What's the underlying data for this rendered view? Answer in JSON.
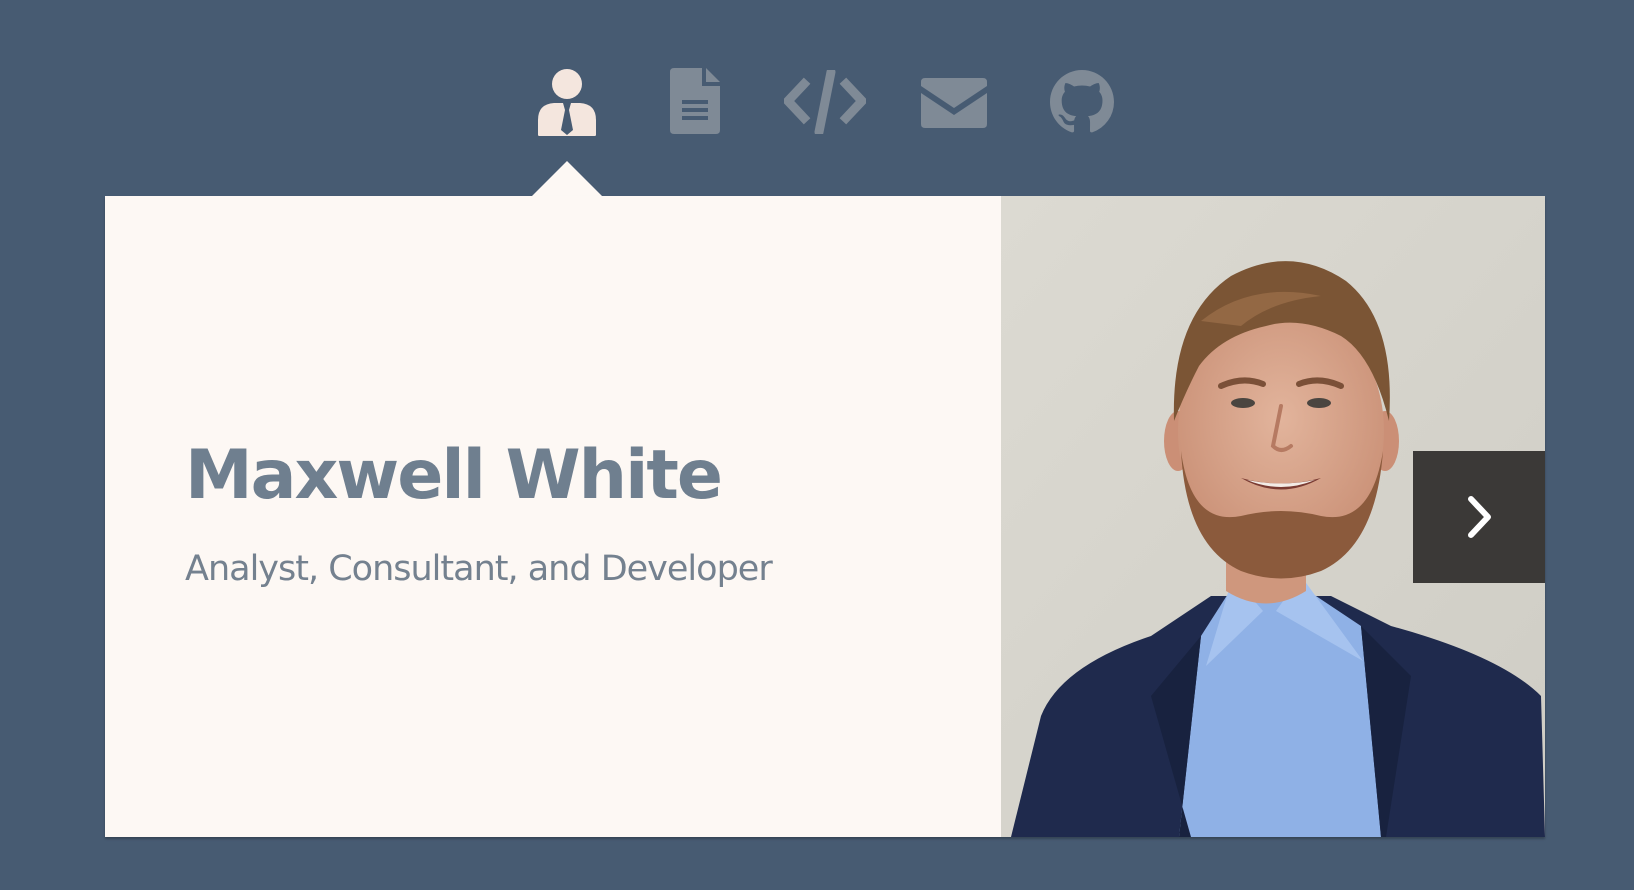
{
  "nav": {
    "items": [
      {
        "icon": "person-with-tie-icon",
        "active": true
      },
      {
        "icon": "document-icon",
        "active": false
      },
      {
        "icon": "code-icon",
        "active": false
      },
      {
        "icon": "envelope-icon",
        "active": false
      },
      {
        "icon": "github-icon",
        "active": false
      }
    ]
  },
  "profile": {
    "name": "Maxwell White",
    "tagline": "Analyst, Consultant, and Developer"
  },
  "carousel": {
    "next_icon": "chevron-right-icon"
  },
  "colors": {
    "background": "#475b72",
    "card": "#fdf8f4",
    "active_icon": "#f4e6de",
    "inactive_icon": "#7f8a96",
    "heading_text": "#6f7f8f",
    "next_button": "#3b3937"
  }
}
